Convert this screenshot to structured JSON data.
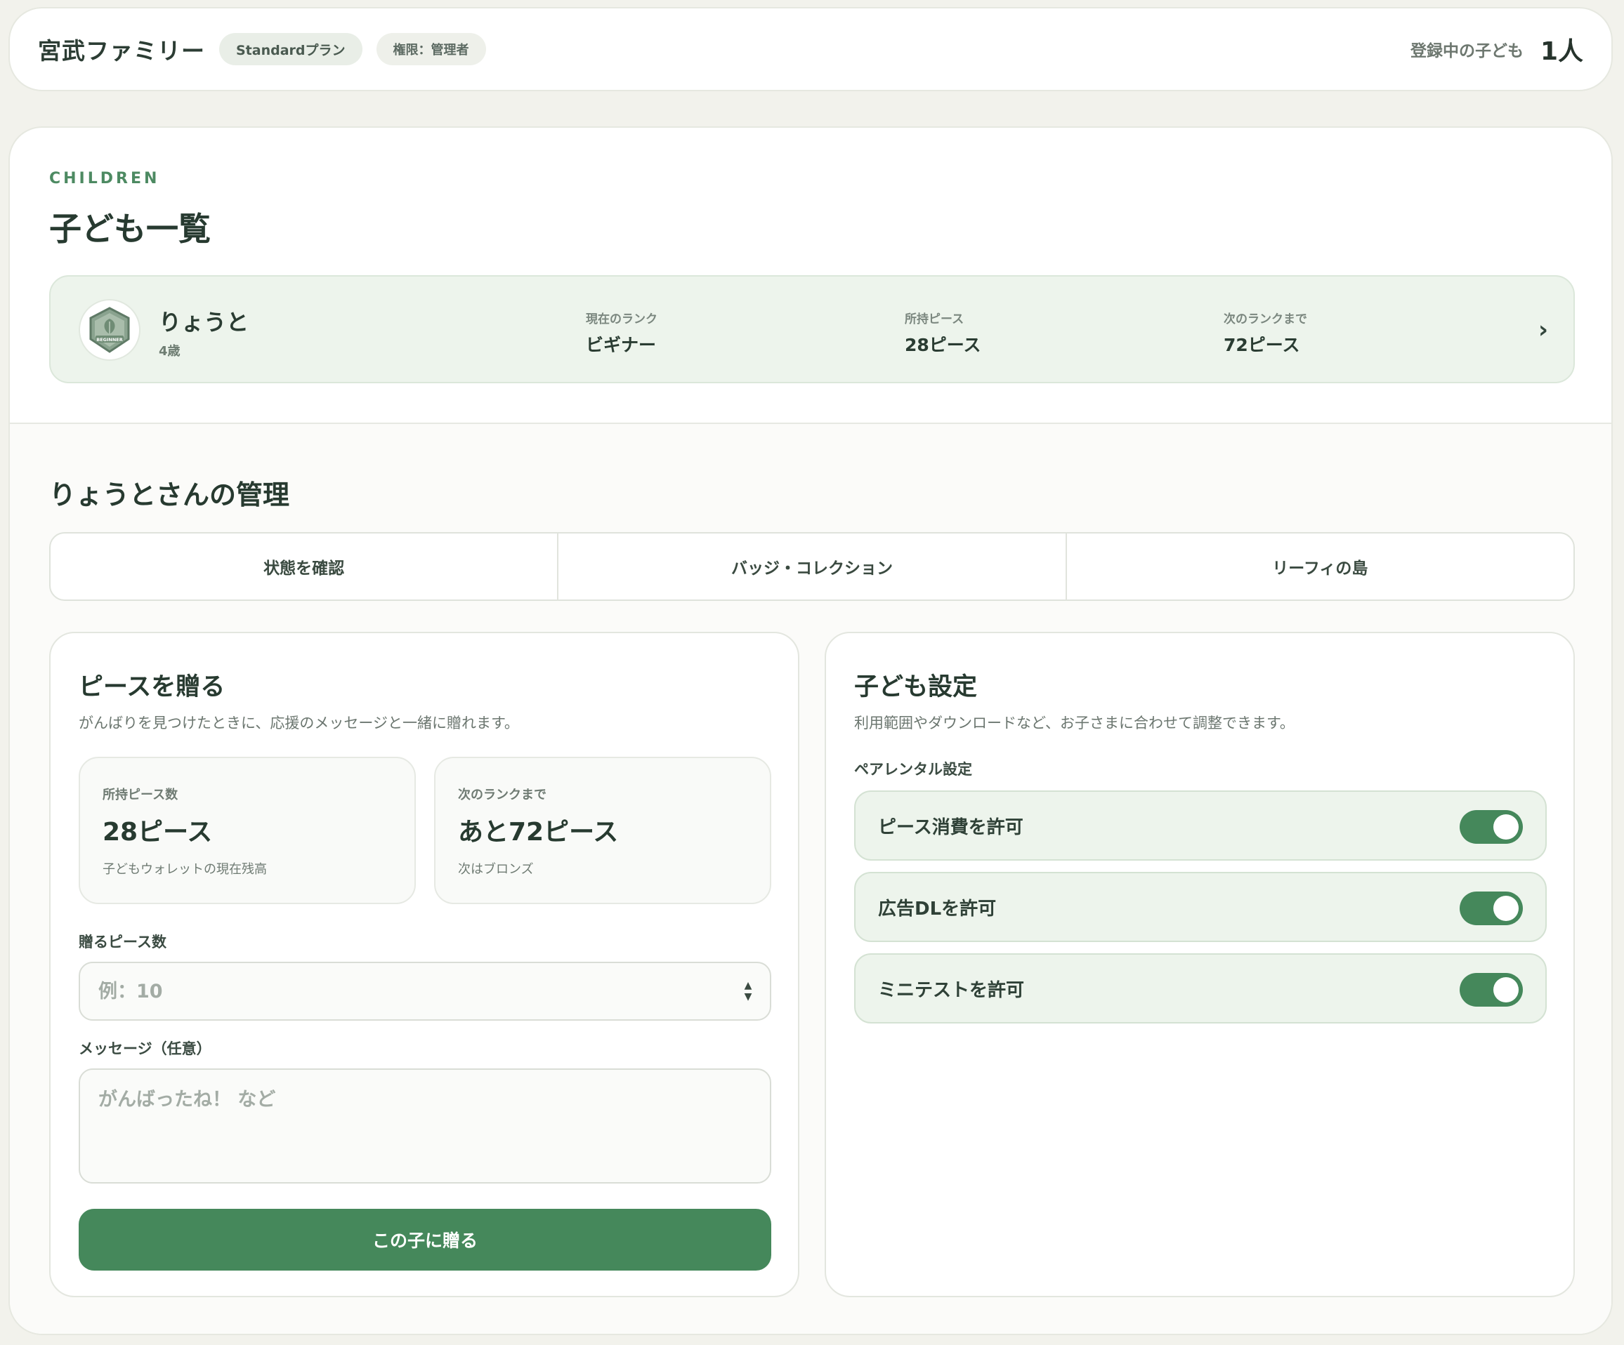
{
  "header": {
    "family_name": "宮武ファミリー",
    "plan_badge": "Standardプラン",
    "role_badge": "権限：管理者",
    "registered_label": "登録中の子ども",
    "registered_count": "1人"
  },
  "children_section": {
    "eyebrow": "CHILDREN",
    "title": "子ども一覧",
    "children": [
      {
        "name": "りょうと",
        "age": "4歳",
        "badge_text": "BEGINNER",
        "rank_label": "現在のランク",
        "rank_value": "ビギナー",
        "pieces_label": "所持ピース",
        "pieces_value": "28ピース",
        "next_label": "次のランクまで",
        "next_value": "72ピース",
        "chevron": "›"
      }
    ]
  },
  "manage": {
    "title": "りょうとさんの管理",
    "tabs": [
      {
        "label": "状態を確認"
      },
      {
        "label": "バッジ・コレクション"
      },
      {
        "label": "リーフィの島"
      }
    ]
  },
  "gift": {
    "title": "ピースを贈る",
    "description": "がんばりを見つけたときに、応援のメッセージと一緒に贈れます。",
    "owned": {
      "label": "所持ピース数",
      "value": "28ピース",
      "sub": "子どもウォレットの現在残高"
    },
    "next": {
      "label": "次のランクまで",
      "value": "あと72ピース",
      "sub": "次はブロンズ"
    },
    "amount_label": "贈るピース数",
    "amount_placeholder": "例：10",
    "amount_value": "",
    "message_label": "メッセージ（任意）",
    "message_placeholder": "がんばったね！ など",
    "message_value": "",
    "submit_label": "この子に贈る"
  },
  "settings": {
    "title": "子ども設定",
    "description": "利用範囲やダウンロードなど、お子さまに合わせて調整できます。",
    "parental_label": "ペアレンタル設定",
    "toggles": [
      {
        "label": "ピース消費を許可",
        "on": true
      },
      {
        "label": "広告DLを許可",
        "on": true
      },
      {
        "label": "ミニテストを許可",
        "on": true
      }
    ]
  },
  "colors": {
    "accent": "#45885b",
    "accent_soft": "#edf4ec",
    "text_dark": "#273a30",
    "page_bg": "#f2f2ec"
  }
}
